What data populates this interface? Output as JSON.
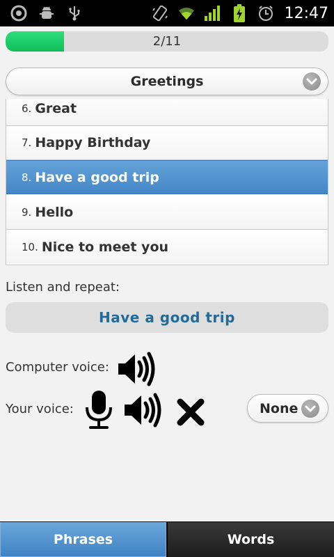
{
  "status_bar": {
    "left_icons": [
      "record-icon",
      "android-debug-icon",
      "usb-icon"
    ],
    "right_icons": [
      "rotate-icon",
      "wifi-icon",
      "signal-icon",
      "battery-charging-icon",
      "alarm-icon"
    ],
    "time": "12:47"
  },
  "progress": {
    "text": "2/11",
    "fraction": 0.1818,
    "color": "#17c862"
  },
  "category": {
    "selected": "Greetings"
  },
  "phrases": [
    {
      "num": "6.",
      "text": "Great",
      "selected": false
    },
    {
      "num": "7.",
      "text": "Happy Birthday",
      "selected": false
    },
    {
      "num": "8.",
      "text": "Have a good trip",
      "selected": true
    },
    {
      "num": "9.",
      "text": "Hello",
      "selected": false
    },
    {
      "num": "10.",
      "text": "Nice to meet you",
      "selected": false
    }
  ],
  "listen": {
    "label": "Listen and repeat:",
    "phrase": "Have a good trip"
  },
  "computer_voice": {
    "label": "Computer voice:"
  },
  "your_voice": {
    "label": "Your voice:",
    "rating": "None"
  },
  "tabs": [
    {
      "label": "Phrases",
      "active": true
    },
    {
      "label": "Words",
      "active": false
    }
  ],
  "colors": {
    "selected_row": "#4f93d0",
    "phrase_text": "#236a96"
  }
}
